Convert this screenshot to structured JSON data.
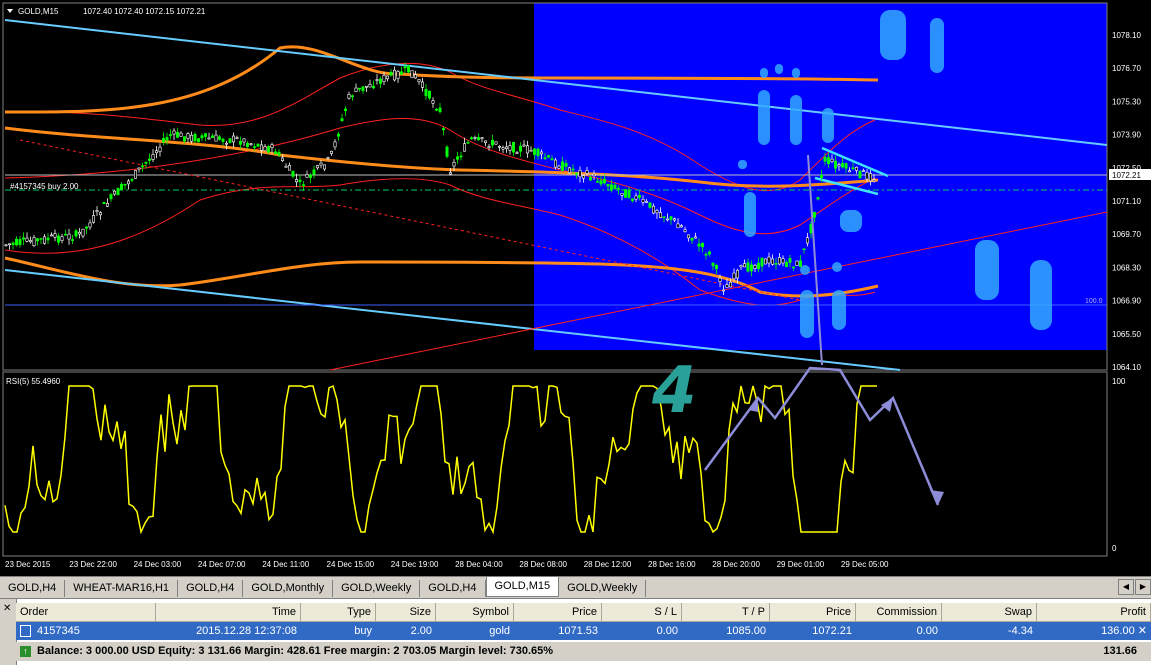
{
  "chart": {
    "title": "GOLD,M15",
    "ohlc": "1072.40 1072.40 1072.15 1072.21",
    "position_label": "#4157345 buy 2.00",
    "price_axis": [
      "1078.10",
      "1076.70",
      "1075.30",
      "1073.90",
      "1072.50",
      "1071.10",
      "1069.70",
      "1068.30",
      "1066.90",
      "1065.50",
      "1064.10"
    ],
    "current_price": "1072.21",
    "level_100": "100.0",
    "rsi_label": "RSI(5) 55.4960",
    "rsi_axis": [
      "100",
      "0"
    ],
    "time_axis": [
      "23 Dec 2015",
      "23 Dec 22:00",
      "24 Dec 03:00",
      "24 Dec 07:00",
      "24 Dec 11:00",
      "24 Dec 15:00",
      "24 Dec 19:00",
      "28 Dec 04:00",
      "28 Dec 08:00",
      "28 Dec 12:00",
      "28 Dec 16:00",
      "28 Dec 20:00",
      "29 Dec 01:00",
      "29 Dec 05:00"
    ],
    "annotation": "4",
    "colors": {
      "background": "#000000",
      "highlight": "#0000ff",
      "bull": "#00ff00",
      "bear": "#ffffff",
      "bands": "#ff0000",
      "ma": "#ff8c1a",
      "trend": "#66ccff",
      "rsi": "#ffff00",
      "arrows": "#8c8cd9",
      "annotation": "#2aa198"
    }
  },
  "tabs": [
    "GOLD,H4",
    "WHEAT-MAR16,H1",
    "GOLD,H4",
    "GOLD,Monthly",
    "GOLD,Weekly",
    "GOLD,H4",
    "GOLD,M15",
    "GOLD,Weekly"
  ],
  "active_tab": "GOLD,M15",
  "terminal": {
    "headers": [
      "Order",
      "Time",
      "Type",
      "Size",
      "Symbol",
      "Price",
      "S / L",
      "T / P",
      "Price",
      "Commission",
      "Swap",
      "Profit"
    ],
    "row": [
      "4157345",
      "2015.12.28 12:37:08",
      "buy",
      "2.00",
      "gold",
      "1071.53",
      "0.00",
      "1085.00",
      "1072.21",
      "0.00",
      "-4.34",
      "136.00"
    ],
    "balance": "Balance: 3 000.00 USD  Equity: 3 131.66  Margin: 428.61  Free margin: 2 703.05  Margin level: 730.65%",
    "balance_profit": "131.66"
  }
}
